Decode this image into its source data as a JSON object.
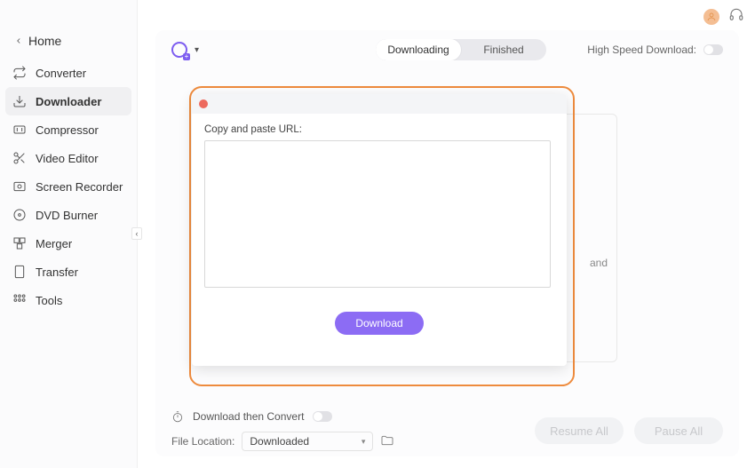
{
  "home_label": "Home",
  "sidebar": {
    "items": [
      {
        "label": "Converter"
      },
      {
        "label": "Downloader"
      },
      {
        "label": "Compressor"
      },
      {
        "label": "Video Editor"
      },
      {
        "label": "Screen Recorder"
      },
      {
        "label": "DVD Burner"
      },
      {
        "label": "Merger"
      },
      {
        "label": "Transfer"
      },
      {
        "label": "Tools"
      }
    ]
  },
  "tabs": {
    "downloading": "Downloading",
    "finished": "Finished"
  },
  "high_speed_label": "High Speed Download:",
  "hidden_hint": "and",
  "modal": {
    "label": "Copy and paste URL:",
    "download_btn": "Download"
  },
  "footer": {
    "convert_label": "Download then Convert",
    "location_label": "File Location:",
    "location_value": "Downloaded",
    "resume_label": "Resume All",
    "pause_label": "Pause All"
  }
}
